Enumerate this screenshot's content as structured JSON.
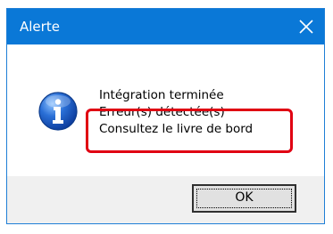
{
  "window": {
    "title": "Alerte"
  },
  "message": {
    "icon": "info-icon",
    "lines": [
      "Intégration terminée",
      "Erreur(s) détectée(s)",
      "Consultez le livre de bord"
    ]
  },
  "buttons": {
    "ok_label": "OK"
  },
  "colors": {
    "titlebar": "#0a78d7",
    "highlight": "#e00012",
    "footer": "#f0f0f0"
  }
}
